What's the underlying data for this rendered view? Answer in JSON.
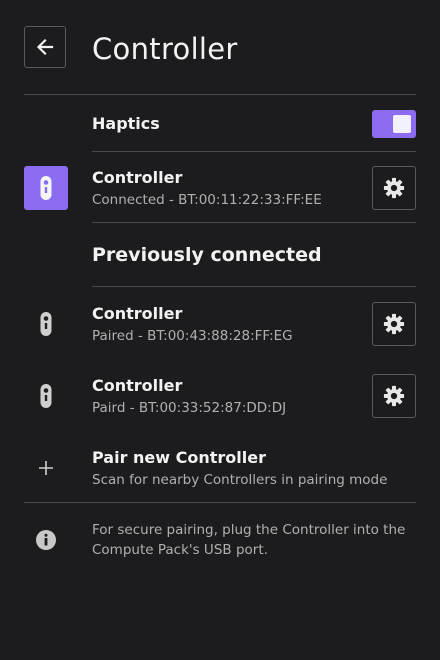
{
  "header": {
    "title": "Controller"
  },
  "haptics": {
    "label": "Haptics",
    "enabled": true
  },
  "current": {
    "label": "Controller",
    "status": "Connected - BT:00:11:22:33:FF:EE"
  },
  "previous": {
    "title": "Previously connected",
    "items": [
      {
        "label": "Controller",
        "status": "Paired - BT:00:43:88:28:FF:EG"
      },
      {
        "label": "Controller",
        "status": "Paird - BT:00:33:52:87:DD:DJ"
      }
    ]
  },
  "pair_new": {
    "label": "Pair new Controller",
    "description": "Scan for nearby Controllers in pairing mode"
  },
  "info": {
    "text": "For secure pairing, plug the Controller into the Compute Pack's USB port."
  },
  "colors": {
    "accent": "#8c6cf0",
    "background": "#1c1c1e",
    "divider": "#4a4a4c"
  },
  "icons": [
    "back-arrow-icon",
    "controller-icon",
    "gear-icon",
    "plus-icon",
    "info-icon"
  ]
}
